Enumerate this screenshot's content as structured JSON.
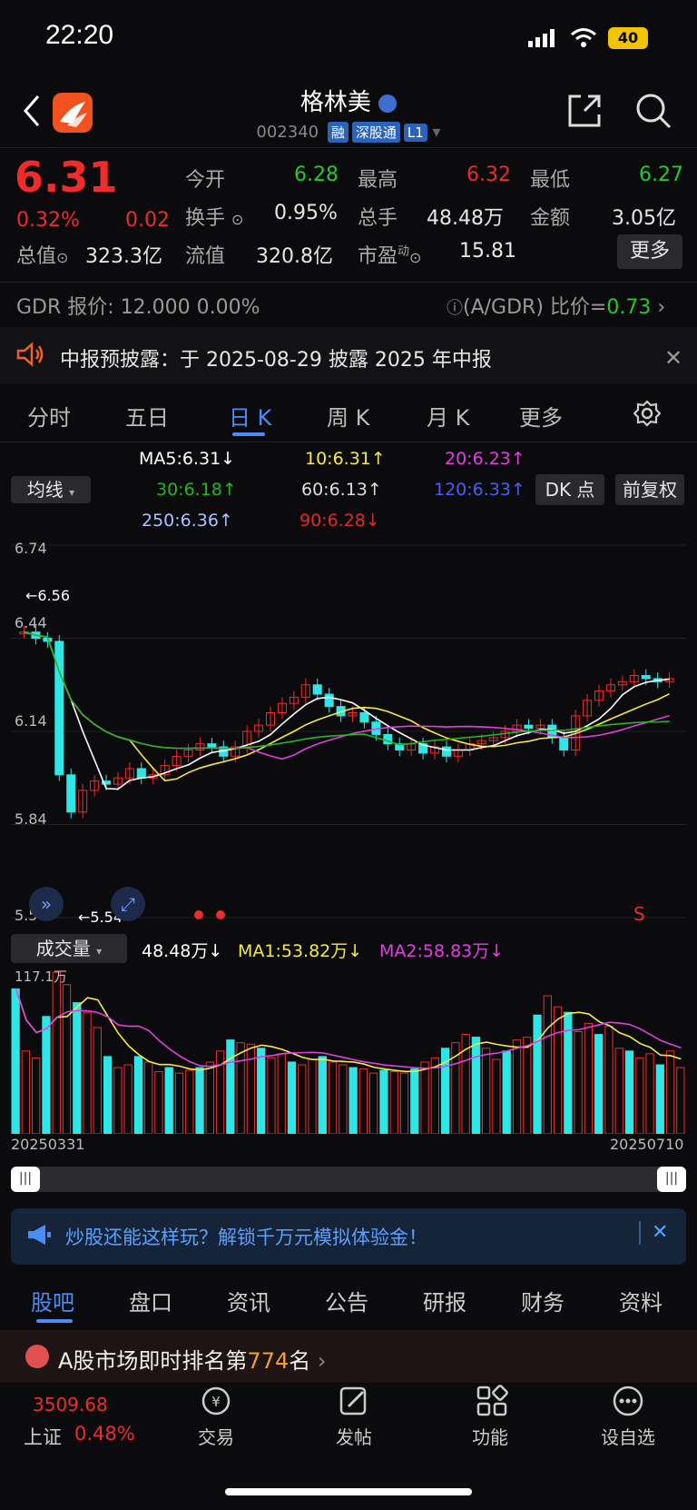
{
  "status": {
    "time": "22:20",
    "battery": "40"
  },
  "header": {
    "name": "格林美",
    "code": "002340",
    "tags": [
      "融",
      "深股通",
      "L1"
    ]
  },
  "quote": {
    "price": "6.31",
    "change_pct": "0.32%",
    "change": "0.02",
    "open_label": "今开",
    "open": "6.28",
    "high_label": "最高",
    "high": "6.32",
    "low_label": "最低",
    "low": "6.27",
    "turnover_label": "换手",
    "turnover": "0.95%",
    "volume_label": "总手",
    "volume": "48.48万",
    "amount_label": "金额",
    "amount": "3.05亿",
    "mktcap_label": "总值",
    "mktcap": "323.3亿",
    "float_label": "流值",
    "float": "320.8亿",
    "pe_label": "市盈",
    "pe_sup": "动",
    "pe": "15.81",
    "more": "更多"
  },
  "gdr": {
    "label": "GDR 报价:",
    "price": "12.000",
    "pct": "0.00%",
    "ratio_label": "(A/GDR) 比价=",
    "ratio": "0.73"
  },
  "notice": {
    "text": "中报预披露：于 2025-08-29 披露 2025 年中报"
  },
  "period_tabs": [
    "分时",
    "五日",
    "日 K",
    "周 K",
    "月 K",
    "更多"
  ],
  "ma": {
    "select": "均线",
    "ma5": "MA5:6.31↓",
    "ma10": "10:6.31↑",
    "ma20": "20:6.23↑",
    "ma30": "30:6.18↑",
    "ma60": "60:6.13↑",
    "ma120": "120:6.33↑",
    "ma250": "250:6.36↑",
    "ma90": "90:6.28↓",
    "dk": "DK 点",
    "fq": "前复权",
    "colors": {
      "ma5": "#ffffff",
      "ma10": "#f5e84a",
      "ma20": "#e040e0",
      "ma30": "#21b521",
      "ma60": "#bbbbbb",
      "ma120": "#4a5ef0",
      "ma250": "#a9c3ff",
      "ma90": "#e02a2a"
    }
  },
  "chart_data": [
    {
      "type": "candlestick",
      "y_ticks": [
        "6.74",
        "6.44",
        "6.14",
        "5.84",
        "5.54"
      ],
      "ylim": [
        5.54,
        6.74
      ],
      "annotations": {
        "high": "6.56",
        "low": "5.54"
      },
      "close": [
        6.46,
        6.44,
        6.43,
        6.0,
        5.88,
        5.95,
        5.98,
        5.97,
        5.99,
        6.02,
        5.99,
        6.0,
        6.03,
        6.06,
        6.08,
        6.1,
        6.09,
        6.06,
        6.09,
        6.14,
        6.16,
        6.2,
        6.23,
        6.25,
        6.29,
        6.26,
        6.22,
        6.19,
        6.2,
        6.17,
        6.13,
        6.1,
        6.08,
        6.1,
        6.07,
        6.09,
        6.06,
        6.08,
        6.1,
        6.11,
        6.12,
        6.14,
        6.16,
        6.15,
        6.16,
        6.12,
        6.08,
        6.19,
        6.24,
        6.27,
        6.29,
        6.3,
        6.32,
        6.31,
        6.3,
        6.31
      ]
    },
    {
      "type": "bar",
      "title": "成交量",
      "value_label": "48.48万↓",
      "ma1": "MA1:53.82万↓",
      "ma2": "MA2:58.83万↓",
      "y_max_label": "117.1万",
      "x_start": "20250331",
      "x_end": "20250710",
      "values": [
        105,
        60,
        55,
        85,
        117,
        108,
        95,
        88,
        77,
        56,
        48,
        50,
        56,
        52,
        45,
        48,
        44,
        46,
        48,
        52,
        60,
        68,
        66,
        65,
        62,
        55,
        58,
        52,
        50,
        54,
        56,
        52,
        50,
        48,
        47,
        44,
        46,
        45,
        44,
        47,
        52,
        55,
        62,
        66,
        72,
        70,
        62,
        54,
        60,
        68,
        70,
        86,
        100,
        92,
        88,
        74,
        80,
        72,
        78,
        62,
        60,
        55,
        58,
        50,
        60,
        48
      ]
    }
  ],
  "promo": {
    "text": "炒股还能这样玩？解锁千万元模拟体验金！"
  },
  "bottom_tabs": [
    "股吧",
    "盘口",
    "资讯",
    "公告",
    "研报",
    "财务",
    "资料"
  ],
  "rank": {
    "prefix": "A股市场即时排名第",
    "num": "774",
    "suffix": "名"
  },
  "index": {
    "value": "3509.68",
    "name": "上证",
    "pct": "0.48%"
  },
  "nav": {
    "trade": "交易",
    "post": "发帖",
    "func": "功能",
    "fav": "设自选"
  }
}
